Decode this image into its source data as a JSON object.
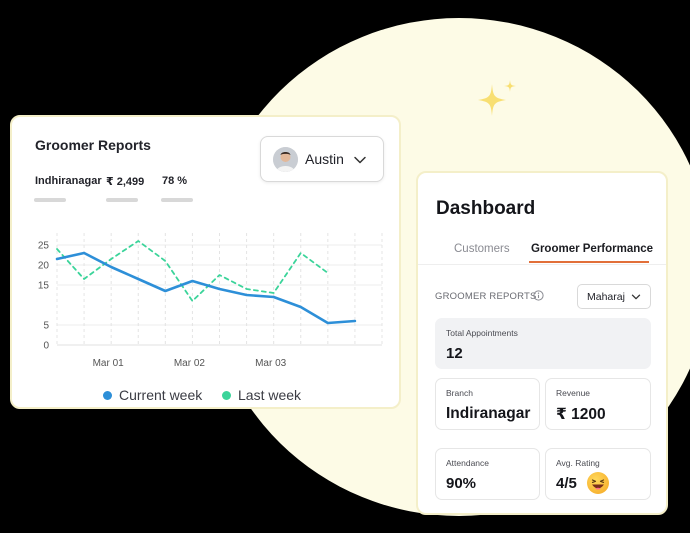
{
  "reports": {
    "title": "Groomer Reports",
    "groomer": "Austin",
    "stats": [
      {
        "label": "Indhiranagar"
      },
      {
        "label": "₹ 2,499"
      },
      {
        "label": "78 %"
      }
    ]
  },
  "chart_data": {
    "type": "line",
    "title": "",
    "xlabel": "",
    "ylabel": "",
    "x": [
      0,
      1,
      2,
      3,
      4,
      5,
      6,
      7,
      8,
      9,
      10,
      11,
      12
    ],
    "x_ticks": [
      {
        "x": 2,
        "label": "Mar 01"
      },
      {
        "x": 5,
        "label": "Mar 02"
      },
      {
        "x": 8,
        "label": "Mar 03"
      }
    ],
    "ylim": [
      0,
      28
    ],
    "y_ticks": [
      0,
      5,
      15,
      20,
      25
    ],
    "grid": true,
    "legend_position": "bottom",
    "series": [
      {
        "name": "Current week",
        "color": "#2d8fd8",
        "style": "solid",
        "values": [
          21.5,
          23,
          19.5,
          16.5,
          13.5,
          16,
          14,
          12.5,
          12,
          9.5,
          5.5,
          6
        ]
      },
      {
        "name": "Last week",
        "color": "#3bd49a",
        "style": "dashed",
        "values": [
          24,
          16.5,
          21.5,
          26,
          21,
          11,
          17.5,
          14,
          13,
          23,
          18
        ]
      }
    ]
  },
  "dashboard": {
    "title": "Dashboard",
    "tabs": {
      "customers": "Customers",
      "groomer_performance": "Groomer Performance"
    },
    "section_label": "GROOMER REPORTS",
    "branch": "Maharaj",
    "tiles": {
      "appointments": {
        "label": "Total Appointments",
        "value": "12"
      },
      "branch": {
        "label": "Branch",
        "value": "Indiranagar"
      },
      "revenue": {
        "label": "Revenue",
        "value": "₹ 1200"
      },
      "attendance": {
        "label": "Attendance",
        "value": "90%"
      },
      "rating": {
        "label": "Avg. Rating",
        "value": "4/5"
      }
    }
  },
  "colors": {
    "accent": "#e26f39",
    "current_week": "#2d8fd8",
    "last_week": "#3bd49a"
  }
}
